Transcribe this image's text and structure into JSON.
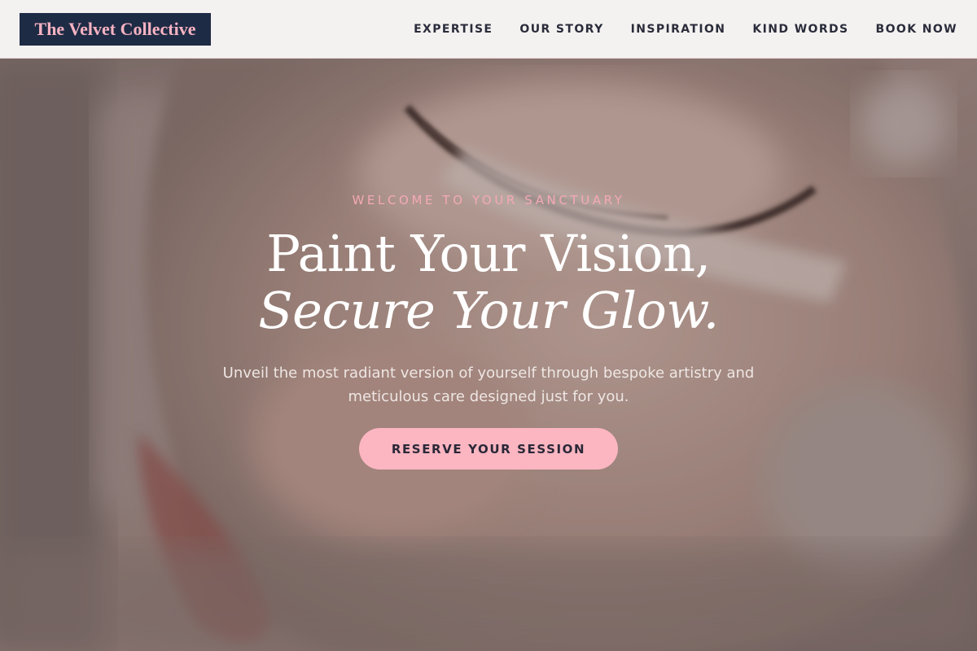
{
  "header": {
    "brand": "The Velvet Collective",
    "nav": [
      {
        "label": "EXPERTISE"
      },
      {
        "label": "OUR STORY"
      },
      {
        "label": "INSPIRATION"
      },
      {
        "label": "KIND WORDS"
      },
      {
        "label": "BOOK NOW"
      }
    ]
  },
  "hero": {
    "eyebrow": "WELCOME TO YOUR SANCTUARY",
    "title_line1": "Paint Your Vision,",
    "title_line2": "Secure Your Glow.",
    "subtitle": "Unveil the most radiant version of yourself through bespoke artistry and meticulous care designed just for you.",
    "cta_label": "RESERVE YOUR SESSION",
    "background_image": "close-up-eye-makeup-photo"
  },
  "colors": {
    "header_bg": "#f4f2f1",
    "brand_bg": "#1e2b45",
    "brand_text": "#f7b3c2",
    "accent_pink": "#fbb6c1",
    "eyebrow_pink": "#f4a9b5",
    "nav_text": "#2a2c3a"
  }
}
